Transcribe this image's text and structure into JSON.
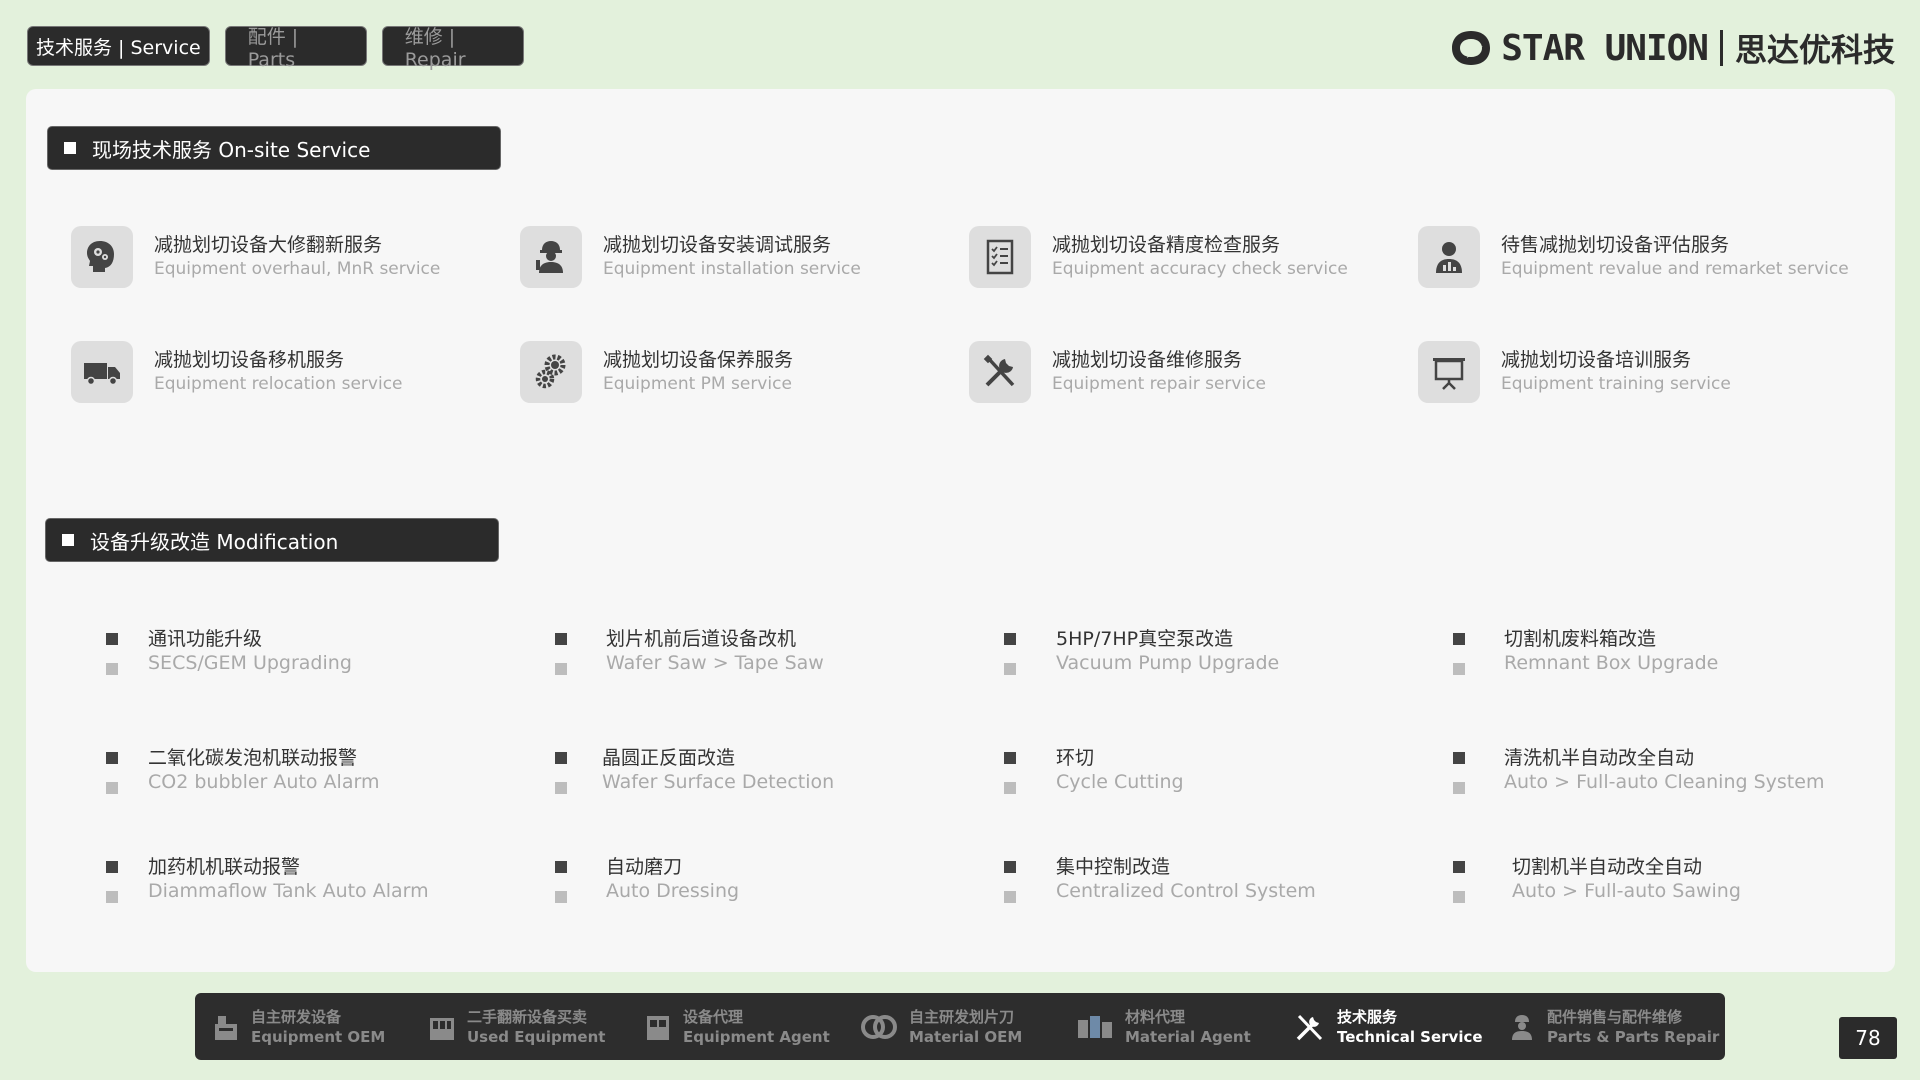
{
  "top_tabs": [
    {
      "label": "技术服务 | Service",
      "active": true
    },
    {
      "label": "配件 | Parts",
      "active": false
    },
    {
      "label": "维修 | Repair",
      "active": false
    }
  ],
  "brand": {
    "name": "STAR UNION",
    "cn": "思达优科技"
  },
  "onsite": {
    "title": "现场技术服务 On-site Service",
    "items": [
      {
        "cn": "减抛划切设备大修翻新服务",
        "en": "Equipment overhaul, MnR service",
        "icon": "head-gears-icon"
      },
      {
        "cn": "减抛划切设备安装调试服务",
        "en": "Equipment installation service",
        "icon": "engineer-icon"
      },
      {
        "cn": "减抛划切设备精度检查服务",
        "en": "Equipment accuracy check service",
        "icon": "checklist-icon"
      },
      {
        "cn": "待售减抛划切设备评估服务",
        "en": "Equipment revalue and remarket service",
        "icon": "person-chart-icon"
      },
      {
        "cn": "减抛划切设备移机服务",
        "en": "Equipment relocation service",
        "icon": "truck-icon"
      },
      {
        "cn": "减抛划切设备保养服务",
        "en": "Equipment PM service",
        "icon": "gears-icon"
      },
      {
        "cn": "减抛划切设备维修服务",
        "en": "Equipment repair service",
        "icon": "tools-icon"
      },
      {
        "cn": "减抛划切设备培训服务",
        "en": "Equipment training service",
        "icon": "presentation-icon"
      }
    ]
  },
  "modification": {
    "title": "设备升级改造 Modification",
    "items": [
      {
        "cn": "通讯功能升级",
        "en": "SECS/GEM Upgrading"
      },
      {
        "cn": "划片机前后道设备改机",
        "en": "Wafer Saw > Tape Saw"
      },
      {
        "cn": "5HP/7HP真空泵改造",
        "en": "Vacuum Pump Upgrade"
      },
      {
        "cn": "切割机废料箱改造",
        "en": "Remnant Box Upgrade"
      },
      {
        "cn": "二氧化碳发泡机联动报警",
        "en": "CO2 bubbler Auto Alarm"
      },
      {
        "cn": "晶圆正反面改造",
        "en": "Wafer Surface Detection"
      },
      {
        "cn": "环切",
        "en": "Cycle Cutting"
      },
      {
        "cn": "清洗机半自动改全自动",
        "en": "Auto > Full-auto Cleaning System"
      },
      {
        "cn": "加药机机联动报警",
        "en": "Diammaflow Tank Auto Alarm"
      },
      {
        "cn": "自动磨刀",
        "en": "Auto Dressing"
      },
      {
        "cn": "集中控制改造",
        "en": "Centralized Control System"
      },
      {
        "cn": "切割机半自动改全自动",
        "en": "Auto > Full-auto Sawing"
      }
    ]
  },
  "bottom_nav": [
    {
      "cn": "自主研发设备",
      "en": "Equipment OEM",
      "icon": "equipment-icon",
      "active": false
    },
    {
      "cn": "二手翻新设备买卖",
      "en": "Used Equipment",
      "icon": "used-equipment-icon",
      "active": false
    },
    {
      "cn": "设备代理",
      "en": "Equipment Agent",
      "icon": "agent-icon",
      "active": false
    },
    {
      "cn": "自主研发划片刀",
      "en": "Material OEM",
      "icon": "blade-icon",
      "active": false
    },
    {
      "cn": "材料代理",
      "en": "Material Agent",
      "icon": "material-icon",
      "active": false
    },
    {
      "cn": "技术服务",
      "en": "Technical Service",
      "icon": "tools-icon",
      "active": true
    },
    {
      "cn": "配件销售与配件维修",
      "en": "Parts & Parts Repair",
      "icon": "worker-icon",
      "active": false
    }
  ],
  "page_number": "78"
}
